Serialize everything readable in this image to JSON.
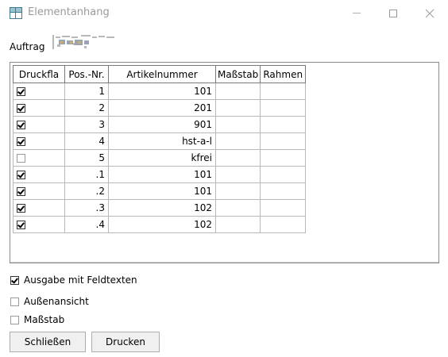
{
  "window": {
    "title": "Elementanhang",
    "minimize_icon": "minimize-icon",
    "maximize_icon": "maximize-icon",
    "close_icon": "close-icon"
  },
  "auftrag": {
    "label": "Auftrag"
  },
  "grid": {
    "headers": [
      "Druckfla",
      "Pos.-Nr.",
      "Artikelnummer",
      "Maßstab",
      "Rahmen"
    ],
    "rows": [
      {
        "checked": true,
        "pos": "1",
        "artikel": "101",
        "massstab": "",
        "rahmen": ""
      },
      {
        "checked": true,
        "pos": "2",
        "artikel": "201",
        "massstab": "",
        "rahmen": ""
      },
      {
        "checked": true,
        "pos": "3",
        "artikel": "901",
        "massstab": "",
        "rahmen": ""
      },
      {
        "checked": true,
        "pos": "4",
        "artikel": "hst-a-l",
        "massstab": "",
        "rahmen": ""
      },
      {
        "checked": false,
        "pos": "5",
        "artikel": "kfrei",
        "massstab": "",
        "rahmen": ""
      },
      {
        "checked": true,
        "pos": ".1",
        "artikel": "101",
        "massstab": "",
        "rahmen": ""
      },
      {
        "checked": true,
        "pos": ".2",
        "artikel": "101",
        "massstab": "",
        "rahmen": ""
      },
      {
        "checked": true,
        "pos": ".3",
        "artikel": "102",
        "massstab": "",
        "rahmen": ""
      },
      {
        "checked": true,
        "pos": ".4",
        "artikel": "102",
        "massstab": "",
        "rahmen": ""
      }
    ]
  },
  "options": {
    "feldtexte": {
      "label": "Ausgabe mit Feldtexten",
      "checked": true
    },
    "aussenansicht": {
      "label": "Außenansicht",
      "checked": false
    },
    "massstab": {
      "label": "Maßstab",
      "checked": false
    }
  },
  "buttons": {
    "close_label": "Schließen",
    "print_label": "Drucken"
  }
}
